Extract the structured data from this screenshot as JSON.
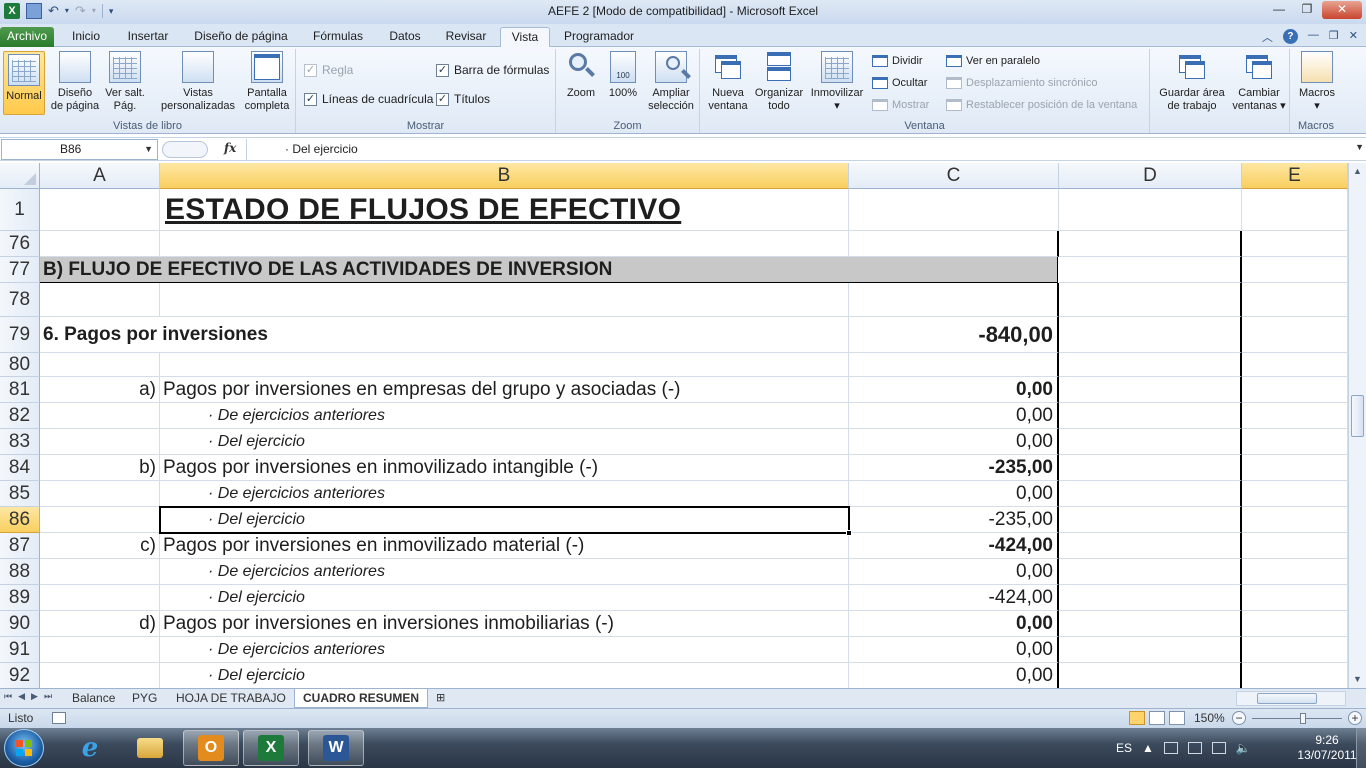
{
  "window": {
    "title": "AEFE 2  [Modo de compatibilidad]  -  Microsoft Excel"
  },
  "tabs": [
    {
      "label": "Archivo",
      "left": 0,
      "width": 54
    },
    {
      "label": "Inicio"
    },
    {
      "label": "Insertar"
    },
    {
      "label": "Diseño de página"
    },
    {
      "label": "Fórmulas"
    },
    {
      "label": "Datos"
    },
    {
      "label": "Revisar"
    },
    {
      "label": "Vista"
    },
    {
      "label": "Programador"
    }
  ],
  "ribbon": {
    "vistas_libro": {
      "group_label": "Vistas de libro",
      "normal": "Normal",
      "diseno_pagina": [
        "Diseño",
        "de página"
      ],
      "ver_salt": [
        "Ver salt.",
        "Pág."
      ],
      "vistas_pers": [
        "Vistas",
        "personalizadas"
      ],
      "pantalla": [
        "Pantalla",
        "completa"
      ]
    },
    "mostrar": {
      "group_label": "Mostrar",
      "regla": "Regla",
      "barra_formulas": "Barra de fórmulas",
      "lineas": "Líneas de cuadrícula",
      "titulos": "Títulos",
      "check": "✓"
    },
    "zoom": {
      "group_label": "Zoom",
      "zoom": "Zoom",
      "cien": "100%",
      "cien_icon": "100",
      "ampliar": [
        "Ampliar",
        "selección"
      ]
    },
    "ventana": {
      "group_label": "Ventana",
      "nueva": [
        "Nueva",
        "ventana"
      ],
      "organizar": [
        "Organizar",
        "todo"
      ],
      "inmovilizar": "Inmovilizar",
      "dividir": "Dividir",
      "ocultar": "Ocultar",
      "mostrar": "Mostrar",
      "paralelo": "Ver en paralelo",
      "desplazamiento": "Desplazamiento sincrónico",
      "restablecer": "Restablecer posición de la ventana",
      "guardar": [
        "Guardar área",
        "de trabajo"
      ],
      "cambiar": [
        "Cambiar",
        "ventanas"
      ]
    },
    "macros": {
      "group_label": "Macros",
      "macros": "Macros"
    }
  },
  "formula_bar": {
    "name_box": "B86",
    "fx": "fx",
    "content": "· Del ejercicio"
  },
  "columns": [
    "A",
    "B",
    "C",
    "D",
    "E"
  ],
  "rows": [
    {
      "num": "1",
      "title": "ESTADO DE FLUJOS DE EFECTIVO"
    },
    {
      "num": "76"
    },
    {
      "num": "77",
      "section": "B) FLUJO DE EFECTIVO DE LAS ACTIVIDADES DE INVERSION"
    },
    {
      "num": "78"
    },
    {
      "num": "79",
      "heading": "6. Pagos por inversiones",
      "value": "-840,00"
    },
    {
      "num": "80"
    },
    {
      "num": "81",
      "label": "a)",
      "text": "Pagos por inversiones en empresas del grupo y asociadas (-)",
      "value": "0,00"
    },
    {
      "num": "82",
      "sub": "· De ejercicios anteriores",
      "value": "0,00"
    },
    {
      "num": "83",
      "sub": "· Del ejercicio",
      "value": "0,00"
    },
    {
      "num": "84",
      "label": "b)",
      "text": "Pagos por inversiones en inmovilizado intangible (-)",
      "value": "-235,00"
    },
    {
      "num": "85",
      "sub": "· De ejercicios anteriores",
      "value": "0,00"
    },
    {
      "num": "86",
      "sub": "· Del ejercicio",
      "value": "-235,00"
    },
    {
      "num": "87",
      "label": "c)",
      "text": "Pagos por inversiones en inmovilizado material (-)",
      "value": "-424,00"
    },
    {
      "num": "88",
      "sub": "· De ejercicios anteriores",
      "value": "0,00"
    },
    {
      "num": "89",
      "sub": "· Del ejercicio",
      "value": "-424,00"
    },
    {
      "num": "90",
      "label": "d)",
      "text": "Pagos por inversiones en inversiones inmobiliarias (-)",
      "value": "0,00"
    },
    {
      "num": "91",
      "sub": "· De ejercicios anteriores",
      "value": "0,00"
    },
    {
      "num": "92",
      "sub": "· Del ejercicio",
      "value": "0,00"
    }
  ],
  "sheet_tabs": [
    "Balance",
    "PYG",
    "HOJA DE TRABAJO",
    "CUADRO RESUMEN"
  ],
  "status": {
    "ready": "Listo",
    "zoom": "150%"
  },
  "taskbar": {
    "lang": "ES",
    "time": "9:26",
    "date": "13/07/2011"
  },
  "colors": {
    "selected_header": "#f9cf5f",
    "section_fill": "#c8c8c8",
    "file_tab": "#2a7a2c",
    "excel_green": "#1d7a3a",
    "word_blue": "#2b5797",
    "outlook_orange": "#e38b1c"
  }
}
